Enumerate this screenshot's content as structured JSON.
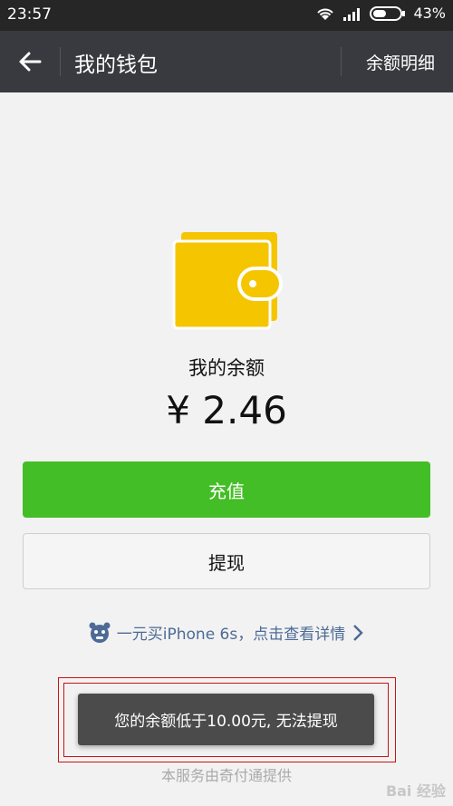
{
  "status_bar": {
    "time": "23:57",
    "battery": "43%"
  },
  "app_bar": {
    "title": "我的钱包",
    "action": "余额明细"
  },
  "wallet": {
    "label": "我的余额",
    "amount": "¥ 2.46"
  },
  "buttons": {
    "recharge": "充值",
    "withdraw": "提现"
  },
  "promo": {
    "text": "一元买iPhone 6s，点击查看详情"
  },
  "toast": {
    "text": "您的余额低于10.00元, 无法提现"
  },
  "footer": {
    "text": "本服务由奇付通提供"
  },
  "watermark": {
    "text": "Bai 经验"
  },
  "colors": {
    "primary": "#44be26",
    "appbar": "#393a3f",
    "wallet": "#f5c500",
    "link": "#4d6b97"
  }
}
